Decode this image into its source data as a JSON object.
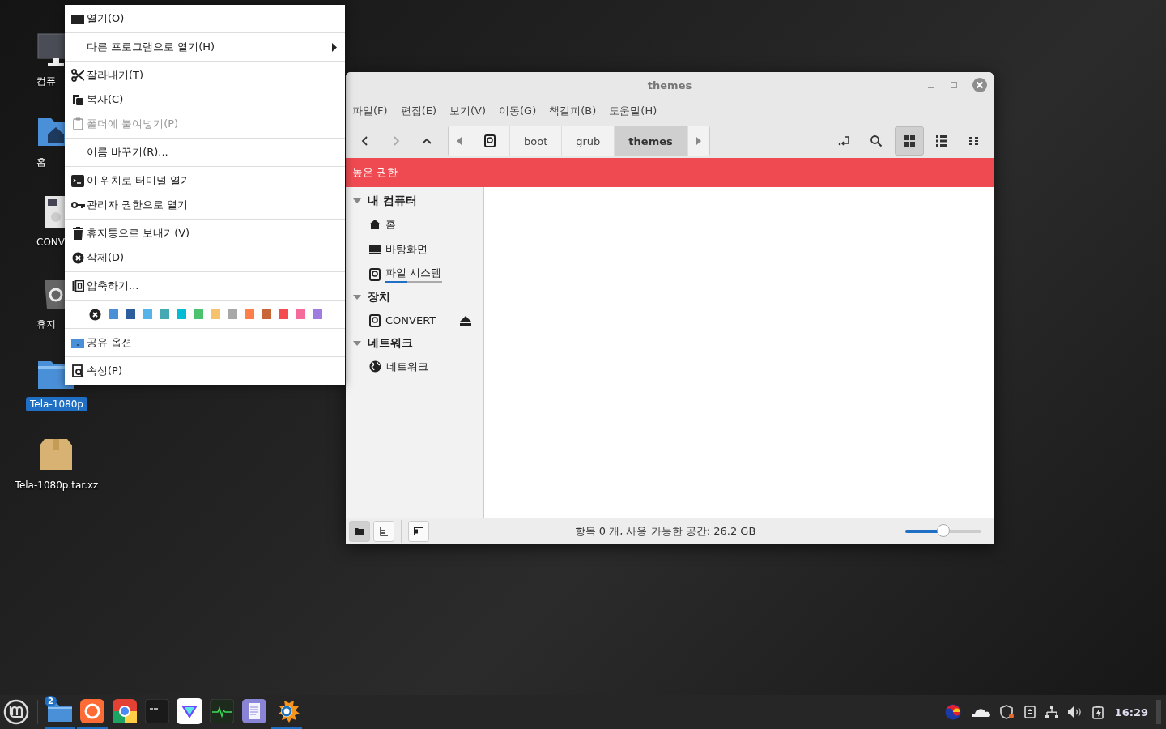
{
  "desktop": {
    "icons": [
      {
        "label": "컴퓨",
        "kind": "computer",
        "selected": false
      },
      {
        "label": "홈",
        "kind": "home",
        "selected": false
      },
      {
        "label": "CONV",
        "kind": "drive",
        "selected": false
      },
      {
        "label": "휴지",
        "kind": "trash",
        "selected": false
      },
      {
        "label": "Tela-1080p",
        "kind": "folder",
        "selected": true
      },
      {
        "label": "Tela-1080p.tar.xz",
        "kind": "archive",
        "selected": false
      }
    ]
  },
  "context_menu": {
    "groups": [
      {
        "kind": "items",
        "items": [
          {
            "label": "열기(O)",
            "kind": "folder",
            "disabled": false
          }
        ]
      },
      {
        "kind": "items",
        "items": [
          {
            "label": "다른 프로그램으로 열기(H)",
            "kind": "none",
            "disabled": false,
            "submenu": true
          }
        ]
      },
      {
        "kind": "items",
        "items": [
          {
            "label": "잘라내기(T)",
            "kind": "scissors",
            "disabled": false
          },
          {
            "label": "복사(C)",
            "kind": "copy",
            "disabled": false
          },
          {
            "label": "폴더에 붙여넣기(P)",
            "kind": "clipboard",
            "disabled": true
          }
        ]
      },
      {
        "kind": "items",
        "items": [
          {
            "label": "이름 바꾸기(R)...",
            "kind": "none",
            "disabled": false
          }
        ]
      },
      {
        "kind": "items",
        "items": [
          {
            "label": "이 위치로 터미널 열기",
            "kind": "terminal",
            "disabled": false
          },
          {
            "label": "관리자 권한으로 열기",
            "kind": "key",
            "disabled": false
          }
        ]
      },
      {
        "kind": "items",
        "items": [
          {
            "label": "휴지통으로 보내기(V)",
            "kind": "trash",
            "disabled": false
          },
          {
            "label": "삭제(D)",
            "kind": "delete",
            "disabled": false
          }
        ]
      },
      {
        "kind": "items",
        "items": [
          {
            "label": "압축하기...",
            "kind": "compress",
            "disabled": false
          }
        ]
      },
      {
        "kind": "colors",
        "colors": [
          {
            "color": "#4a90d9"
          },
          {
            "color": "#2c5d9c"
          },
          {
            "color": "#56b4e9"
          },
          {
            "color": "#45a8b3"
          },
          {
            "color": "#00bcd4"
          },
          {
            "color": "#4cc16e"
          },
          {
            "color": "#f6c26e"
          },
          {
            "color": "#a8a8a8"
          },
          {
            "color": "#ff7f4a"
          },
          {
            "color": "#c8663a"
          },
          {
            "color": "#f44c4f"
          },
          {
            "color": "#f36a9b"
          },
          {
            "color": "#a07be0"
          }
        ]
      },
      {
        "kind": "items",
        "items": [
          {
            "label": "공유 옵션",
            "kind": "share",
            "disabled": false
          }
        ]
      },
      {
        "kind": "items",
        "items": [
          {
            "label": "속성(P)",
            "kind": "properties",
            "disabled": false
          }
        ]
      }
    ]
  },
  "window": {
    "title": "themes",
    "menu": [
      "파일(F)",
      "편집(E)",
      "보기(V)",
      "이동(G)",
      "책갈피(B)",
      "도움말(H)"
    ],
    "nav": [
      {
        "kind": "back",
        "disabled": false
      },
      {
        "kind": "forward",
        "disabled": true
      },
      {
        "kind": "up",
        "disabled": false
      }
    ],
    "path": [
      {
        "kind": "drive",
        "selected": false
      },
      {
        "kind": "folder",
        "label": "boot",
        "selected": false
      },
      {
        "kind": "folder",
        "label": "grub",
        "selected": false
      },
      {
        "kind": "folder",
        "label": "themes",
        "selected": true
      }
    ],
    "views": [
      {
        "kind": "grid",
        "selected": true
      },
      {
        "kind": "list",
        "selected": false
      },
      {
        "kind": "compact",
        "selected": false
      }
    ],
    "banner": "높은 권한",
    "sidebar": [
      {
        "label": "내 컴퓨터",
        "expanded": true,
        "children": [
          {
            "label": "홈",
            "kind": "home"
          },
          {
            "label": "바탕화면",
            "kind": "desktop"
          },
          {
            "label": "파일 시스템",
            "kind": "drive",
            "level": 0.38
          }
        ]
      },
      {
        "label": "장치",
        "expanded": true,
        "children": [
          {
            "label": "CONVERT",
            "kind": "drive",
            "ejectable": true
          }
        ]
      },
      {
        "label": "네트워크",
        "expanded": true,
        "children": [
          {
            "label": "네트워크",
            "kind": "globe"
          }
        ]
      }
    ],
    "status_buttons": [
      {
        "kind": "places",
        "selected": true
      },
      {
        "kind": "tree",
        "selected": false
      }
    ],
    "status": "항목 0 개, 사용 가능한 공간: 26.2 GB",
    "zoom": {
      "level": 0.5
    }
  },
  "taskbar": {
    "apps": [
      {
        "kind": "files",
        "running": true,
        "badge": "2"
      },
      {
        "kind": "firefox",
        "running": true
      },
      {
        "kind": "chrome",
        "running": false
      },
      {
        "kind": "terminal",
        "running": false
      },
      {
        "kind": "vpn",
        "running": false
      },
      {
        "kind": "monitor",
        "running": false
      },
      {
        "kind": "notes",
        "running": false
      },
      {
        "kind": "viewer",
        "running": true
      }
    ],
    "clock": "16:29"
  }
}
